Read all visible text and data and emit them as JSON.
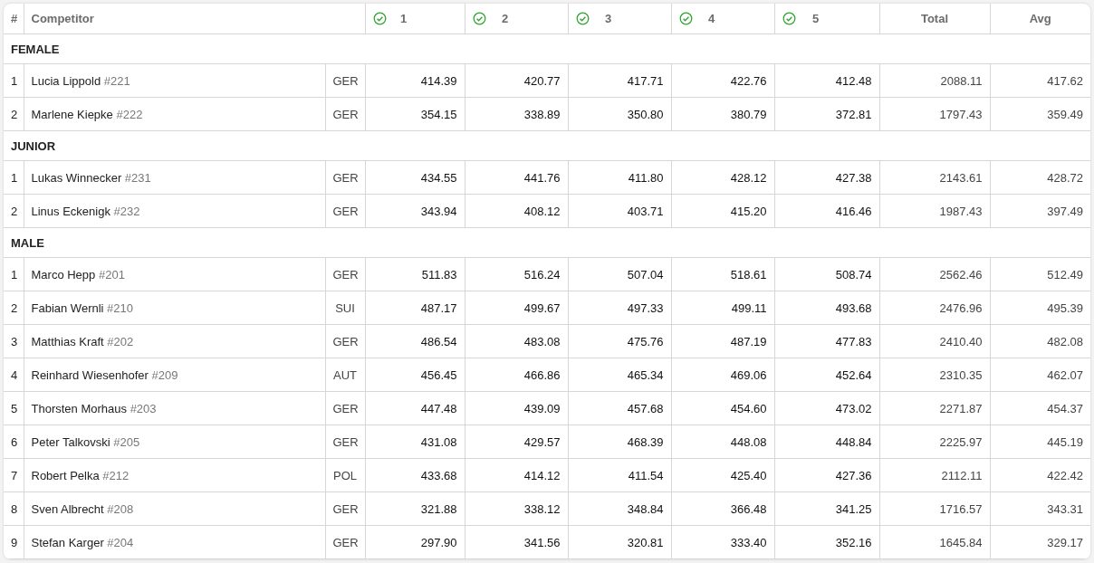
{
  "columns": {
    "rank": "#",
    "competitor": "Competitor",
    "heats": [
      {
        "label": "1",
        "done": true
      },
      {
        "label": "2",
        "done": true
      },
      {
        "label": "3",
        "done": true
      },
      {
        "label": "4",
        "done": true
      },
      {
        "label": "5",
        "done": true
      }
    ],
    "total": "Total",
    "avg": "Avg"
  },
  "groups": [
    {
      "title": "FEMALE",
      "rows": [
        {
          "rank": "1",
          "name": "Lucia Lippold",
          "bib": "#221",
          "nation": "GER",
          "scores": [
            "414.39",
            "420.77",
            "417.71",
            "422.76",
            "412.48"
          ],
          "total": "2088.11",
          "avg": "417.62"
        },
        {
          "rank": "2",
          "name": "Marlene Kiepke",
          "bib": "#222",
          "nation": "GER",
          "scores": [
            "354.15",
            "338.89",
            "350.80",
            "380.79",
            "372.81"
          ],
          "total": "1797.43",
          "avg": "359.49"
        }
      ]
    },
    {
      "title": "JUNIOR",
      "rows": [
        {
          "rank": "1",
          "name": "Lukas Winnecker",
          "bib": "#231",
          "nation": "GER",
          "scores": [
            "434.55",
            "441.76",
            "411.80",
            "428.12",
            "427.38"
          ],
          "total": "2143.61",
          "avg": "428.72"
        },
        {
          "rank": "2",
          "name": "Linus Eckenigk",
          "bib": "#232",
          "nation": "GER",
          "scores": [
            "343.94",
            "408.12",
            "403.71",
            "415.20",
            "416.46"
          ],
          "total": "1987.43",
          "avg": "397.49"
        }
      ]
    },
    {
      "title": "MALE",
      "rows": [
        {
          "rank": "1",
          "name": "Marco Hepp",
          "bib": "#201",
          "nation": "GER",
          "scores": [
            "511.83",
            "516.24",
            "507.04",
            "518.61",
            "508.74"
          ],
          "total": "2562.46",
          "avg": "512.49"
        },
        {
          "rank": "2",
          "name": "Fabian Wernli",
          "bib": "#210",
          "nation": "SUI",
          "scores": [
            "487.17",
            "499.67",
            "497.33",
            "499.11",
            "493.68"
          ],
          "total": "2476.96",
          "avg": "495.39"
        },
        {
          "rank": "3",
          "name": "Matthias Kraft",
          "bib": "#202",
          "nation": "GER",
          "scores": [
            "486.54",
            "483.08",
            "475.76",
            "487.19",
            "477.83"
          ],
          "total": "2410.40",
          "avg": "482.08"
        },
        {
          "rank": "4",
          "name": "Reinhard Wiesenhofer",
          "bib": "#209",
          "nation": "AUT",
          "scores": [
            "456.45",
            "466.86",
            "465.34",
            "469.06",
            "452.64"
          ],
          "total": "2310.35",
          "avg": "462.07"
        },
        {
          "rank": "5",
          "name": "Thorsten Morhaus",
          "bib": "#203",
          "nation": "GER",
          "scores": [
            "447.48",
            "439.09",
            "457.68",
            "454.60",
            "473.02"
          ],
          "total": "2271.87",
          "avg": "454.37"
        },
        {
          "rank": "6",
          "name": "Peter Talkovski",
          "bib": "#205",
          "nation": "GER",
          "scores": [
            "431.08",
            "429.57",
            "468.39",
            "448.08",
            "448.84"
          ],
          "total": "2225.97",
          "avg": "445.19"
        },
        {
          "rank": "7",
          "name": "Robert Pelka",
          "bib": "#212",
          "nation": "POL",
          "scores": [
            "433.68",
            "414.12",
            "411.54",
            "425.40",
            "427.36"
          ],
          "total": "2112.11",
          "avg": "422.42"
        },
        {
          "rank": "8",
          "name": "Sven Albrecht",
          "bib": "#208",
          "nation": "GER",
          "scores": [
            "321.88",
            "338.12",
            "348.84",
            "366.48",
            "341.25"
          ],
          "total": "1716.57",
          "avg": "343.31"
        },
        {
          "rank": "9",
          "name": "Stefan Karger",
          "bib": "#204",
          "nation": "GER",
          "scores": [
            "297.90",
            "341.56",
            "320.81",
            "333.40",
            "352.16"
          ],
          "total": "1645.84",
          "avg": "329.17"
        }
      ]
    }
  ]
}
